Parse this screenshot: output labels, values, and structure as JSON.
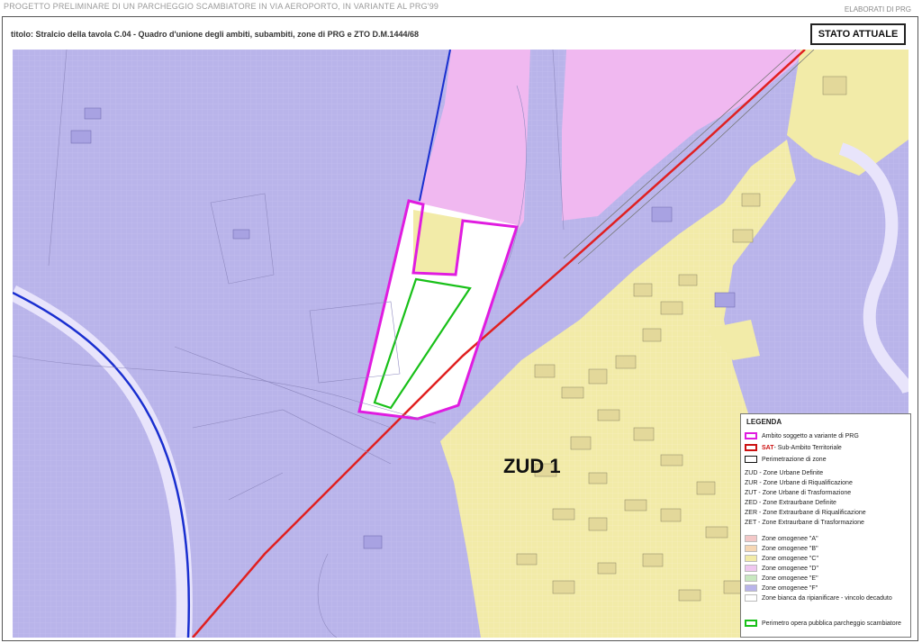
{
  "header": {
    "project_title": "PROGETTO PRELIMINARE DI UN PARCHEGGIO SCAMBIATORE IN VIA AEROPORTO, IN VARIANTE AL PRG'99",
    "doc_type": "ELABORATI DI PRG",
    "subtitle": "titolo: Stralcio della tavola C.04 - Quadro d'unione degli ambiti, subambiti, zone di PRG e ZTO D.M.1444/68",
    "status": "STATO ATTUALE"
  },
  "map": {
    "zone_label": "ZUD 1",
    "colors": {
      "zone_d_lavender": "#b9b4ea",
      "zone_c_yellow": "#f2eba8",
      "zone_pink": "#f0b8f0",
      "road_red": "#e02020",
      "road_blue": "#1a2fd0",
      "ambito_magenta": "#e01ce0",
      "perimetro_green": "#18c018"
    }
  },
  "legend": {
    "title": "LEGENDA",
    "items": [
      {
        "label": "Ambito soggetto a variante di PRG",
        "code": "",
        "swatch": "magenta-border"
      },
      {
        "label": " - Sub-Ambito Territoriale",
        "code": "SAT",
        "swatch": "red-border"
      },
      {
        "label": "Perimetrazione di zone",
        "code": "",
        "swatch": "black-border"
      },
      {
        "label": "ZUD - Zone Urbane Definite",
        "code": "",
        "swatch": "none"
      },
      {
        "label": "ZUR - Zone Urbane di Riqualificazione",
        "code": "",
        "swatch": "none"
      },
      {
        "label": "ZUT - Zone Urbane di Trasformazione",
        "code": "",
        "swatch": "none"
      },
      {
        "label": "ZED - Zone Extraurbane Definite",
        "code": "",
        "swatch": "none"
      },
      {
        "label": "ZER - Zone Extraurbane di Riqualificazione",
        "code": "",
        "swatch": "none"
      },
      {
        "label": "ZET - Zone Extraurbane di Trasformazione",
        "code": "",
        "swatch": "none"
      },
      {
        "label": "Zone omogenee \"A\"",
        "code": "",
        "swatch": "#f3c8c8"
      },
      {
        "label": "Zone omogenee \"B\"",
        "code": "",
        "swatch": "#f6d7b4"
      },
      {
        "label": "Zone omogenee \"C\"",
        "code": "",
        "swatch": "#f2eba8"
      },
      {
        "label": "Zone omogenee \"D\"",
        "code": "",
        "swatch": "#f0c8f0"
      },
      {
        "label": "Zone omogenee \"E\"",
        "code": "",
        "swatch": "#c8e8c0"
      },
      {
        "label": "Zone omogenee \"F\"",
        "code": "",
        "swatch": "#b9b4ea"
      },
      {
        "label": "Zone bianca da ripianificare - vincolo decaduto",
        "code": "",
        "swatch": "#ffffff"
      },
      {
        "label": "Perimetro opera pubblica parcheggio scambiatore",
        "code": "",
        "swatch": "green-border"
      }
    ]
  }
}
